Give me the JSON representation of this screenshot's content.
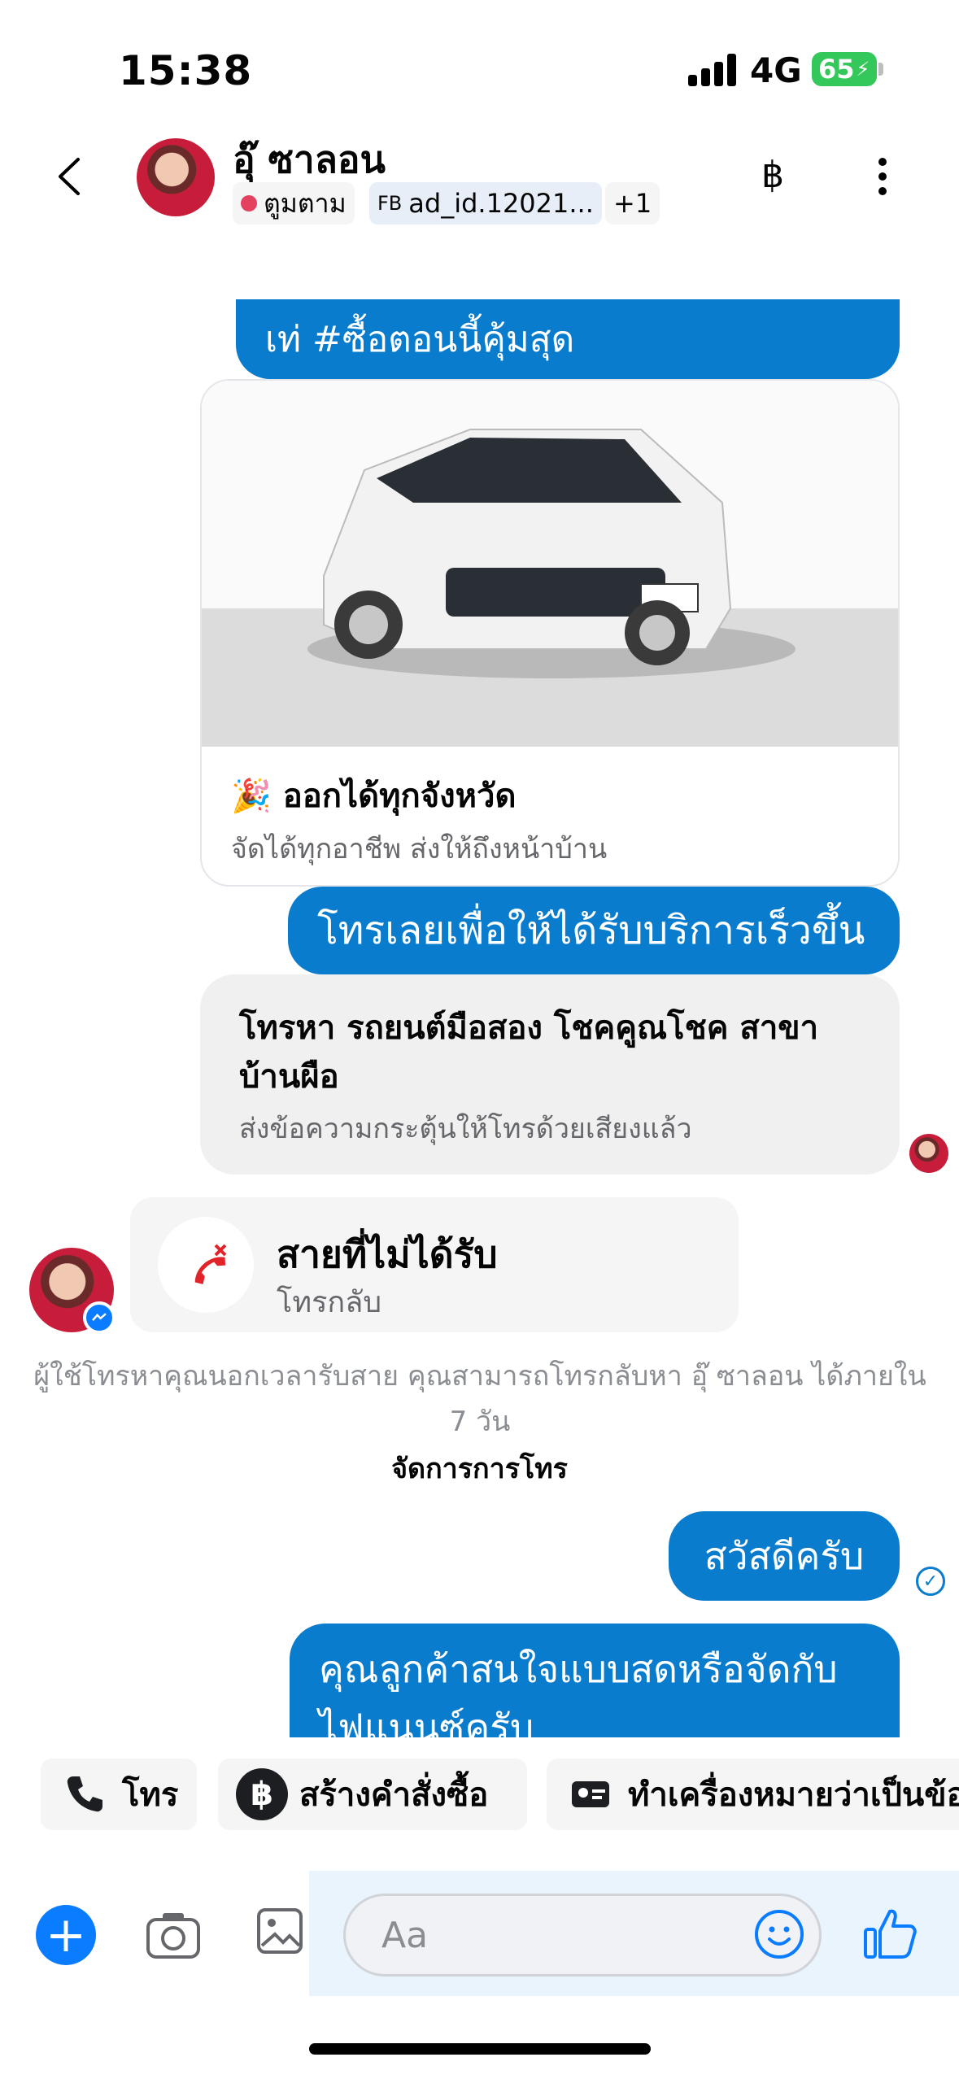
{
  "status_bar": {
    "time": "15:38",
    "network": "4G",
    "battery": "65"
  },
  "header": {
    "contact_name": "อุ๊ ซาลอน",
    "tags": {
      "follow": "ตูมตาม",
      "ad_prefix": "FB",
      "ad_id": "ad_id.12021...",
      "more": "+1"
    },
    "currency_icon": "฿"
  },
  "messages": {
    "hashtag_line": "เท่   #ซื้อตอนนี้คุ้มสุด",
    "card": {
      "emoji": "🎉",
      "title": "ออกได้ทุกจังหวัด",
      "subtitle": "จัดได้ทุกอาชีพ ส่งให้ถึงหน้าบ้าน"
    },
    "cta": "โทรเลยเพื่อให้ได้รับบริการเร็วขึ้น",
    "call_prompt": {
      "title": "โทรหา รถยนต์มือสอง โชคคูณโชค สาขา บ้านผือ",
      "subtitle": "ส่งข้อความกระตุ้นให้โทรด้วยเสียงแล้ว"
    },
    "missed_call": {
      "title": "สายที่ไม่ได้รับ",
      "subtitle": "โทรกลับ"
    },
    "system_text": "ผู้ใช้โทรหาคุณนอกเวลารับสาย คุณสามารถโทรกลับหา อุ๊ ซาลอน ได้ภายใน 7 วัน",
    "manage_calls": "จัดการการโทร",
    "greeting": "สวัสดีครับ",
    "question": "คุณลูกค้าสนใจแบบสดหรือจัดกับไฟแนนซ์ครับ"
  },
  "quick_actions": {
    "call": "โทร",
    "create_order": "สร้างคำสั่งซื้อ",
    "mark": "ทำเครื่องหมายว่าเป็นข้อ"
  },
  "composer": {
    "placeholder": "Aa"
  },
  "colors": {
    "accent": "#0a7cce",
    "messenger_blue": "#0a7cff",
    "missed_red": "#e0242a"
  }
}
